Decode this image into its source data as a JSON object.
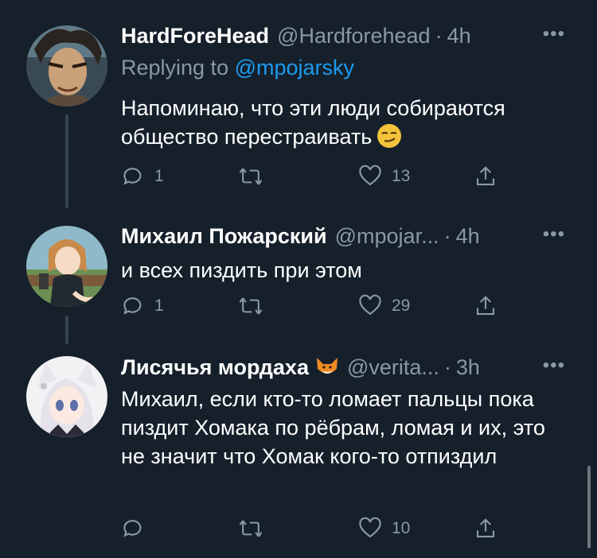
{
  "tweets": [
    {
      "name": "HardForeHead",
      "handle": "@Hardforehead",
      "dot": "·",
      "time": "4h",
      "replying_prefix": "Replying to",
      "replying_mention": "@mpojarsky",
      "text": "Напоминаю, что эти люди собираются общество перестраивать",
      "emoji": "smirking-face",
      "reply_count": "1",
      "retweet_count": "",
      "like_count": "13"
    },
    {
      "name": "Михаил Пожарский",
      "handle": "@mpojar...",
      "dot": "·",
      "time": "4h",
      "text": "и всех пиздить при этом",
      "reply_count": "1",
      "retweet_count": "",
      "like_count": "29"
    },
    {
      "name": "Лисячья мордаха",
      "name_emoji": "fox-face",
      "handle": "@verita...",
      "dot": "·",
      "time": "3h",
      "text": "Михаил, если кто-то ломает пальцы пока пиздит Хомака по рёбрам, ломая и их, это не значит что Хомак кого-то отпиздил",
      "reply_count": "",
      "retweet_count": "",
      "like_count": "10"
    }
  ],
  "more_label": "•••",
  "colors": {
    "background": "#15202b",
    "text_primary": "#ffffff",
    "text_secondary": "#8b98a5",
    "accent": "#1d9bf0",
    "thread_line": "#38444d"
  }
}
